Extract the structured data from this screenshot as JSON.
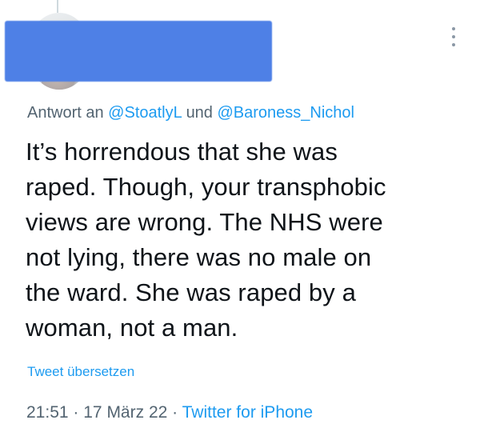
{
  "reply": {
    "prefix": "Antwort an",
    "mention_1": "@StoatlyL",
    "conjunction": "und",
    "mention_2": "@Baroness_Nichol"
  },
  "tweet": {
    "text": "It’s horrendous that she was\nraped. Though, your transphobic\nviews are wrong.  The NHS were\nnot lying, there was no male on\nthe ward. She was raped by a\nwoman, not a man."
  },
  "translate_label": "Tweet übersetzen",
  "meta": {
    "time": "21:51",
    "separator_1": "·",
    "date": "17 März 22",
    "separator_2": "·",
    "source": "Twitter for iPhone"
  },
  "icons": {
    "more": "more-vertical-icon"
  },
  "colors": {
    "link": "#1d9bf0",
    "secondary_text": "#536471",
    "primary_text": "#0f1419",
    "redaction": "#4e80e6"
  }
}
